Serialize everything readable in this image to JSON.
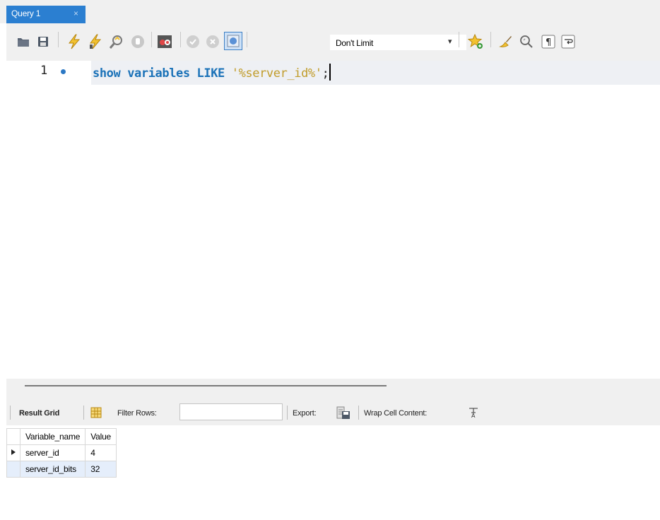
{
  "tab": {
    "title": "Query 1",
    "close": "×"
  },
  "toolbar": {
    "buttons": [
      "open-file-icon",
      "save-icon",
      "execute-icon",
      "execute-current-icon",
      "explain-icon",
      "stop-icon",
      "toggle-error-icon",
      "commit-icon",
      "rollback-icon",
      "autocommit-icon",
      "beautify-snippet-icon",
      "beautify-icon",
      "find-icon",
      "invisible-chars-icon",
      "wrap-lines-icon"
    ],
    "limit": {
      "value": "Don't Limit",
      "arrow": "▾"
    }
  },
  "editor": {
    "line_number": "1",
    "code": {
      "kw1": "show",
      "kw2": "variables",
      "kw3": "LIKE",
      "string": "'%server_id%'",
      "end": ";"
    }
  },
  "result": {
    "result_grid": "Result Grid",
    "filter_rows": "Filter Rows:",
    "export": "Export:",
    "wrap": "Wrap Cell Content:",
    "columns": [
      "Variable_name",
      "Value"
    ],
    "rows": [
      {
        "name": "server_id",
        "value": "4"
      },
      {
        "name": "server_id_bits",
        "value": "32"
      }
    ]
  },
  "colors": {
    "tab": "#2b7fd1",
    "keyword": "#1b72b8",
    "string": "#c19c2a"
  }
}
